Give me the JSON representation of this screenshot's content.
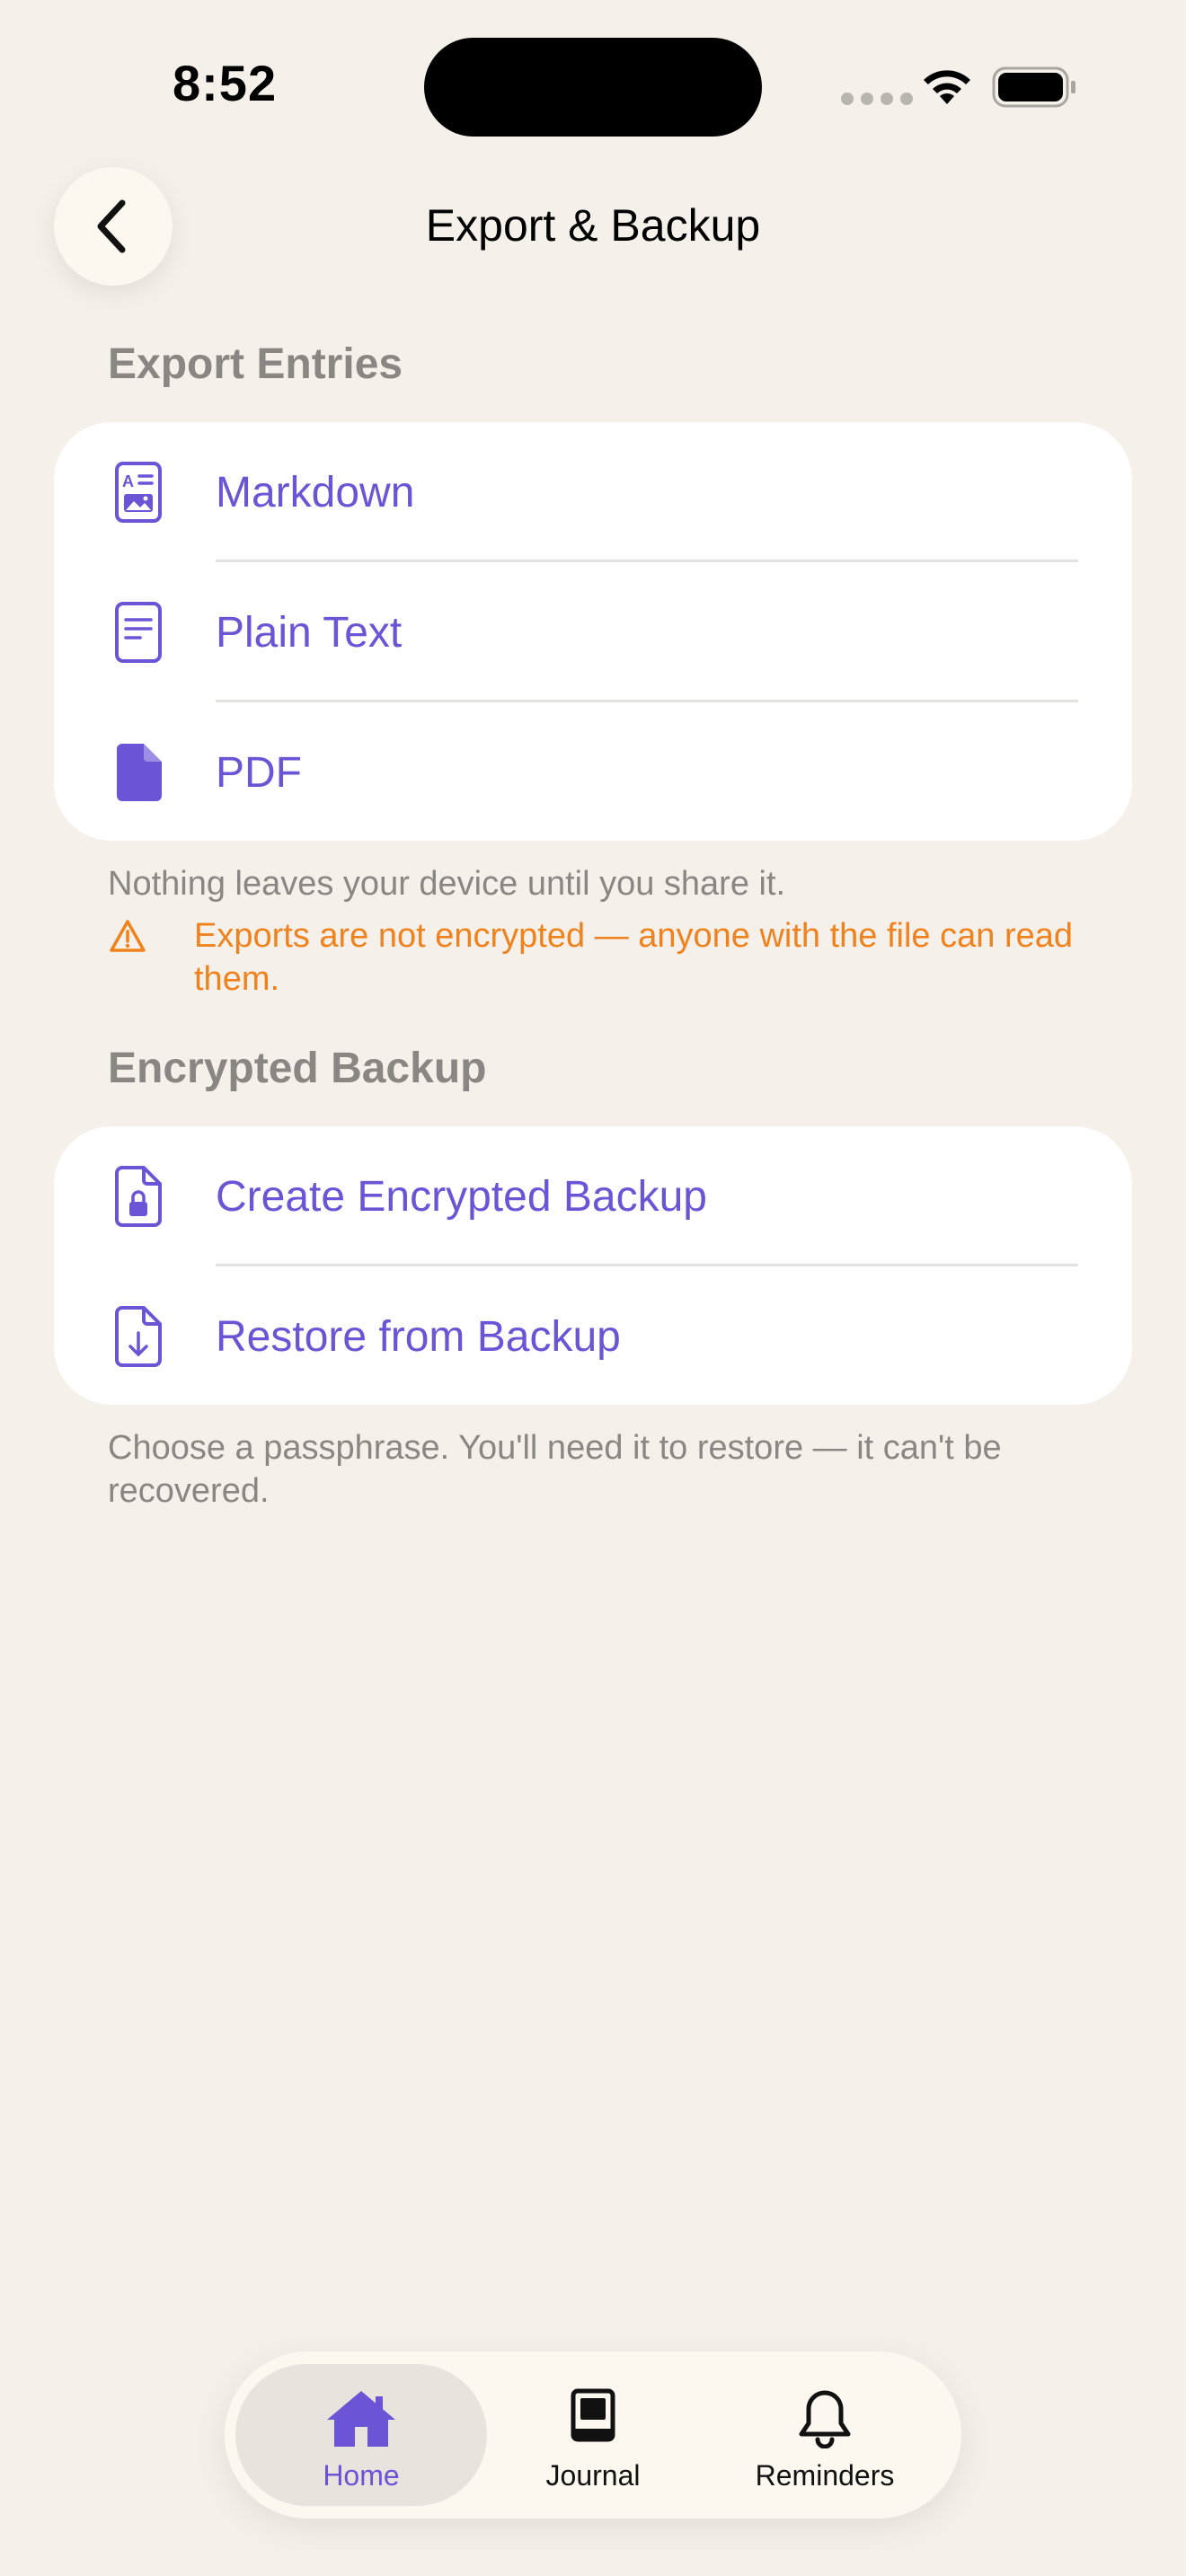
{
  "status_bar": {
    "time": "8:52"
  },
  "nav": {
    "title": "Export & Backup"
  },
  "export": {
    "header": "Export Entries",
    "items": [
      {
        "label": "Markdown",
        "icon": "markdown-doc-icon"
      },
      {
        "label": "Plain Text",
        "icon": "text-doc-icon"
      },
      {
        "label": "PDF",
        "icon": "pdf-doc-icon"
      }
    ],
    "note": "Nothing leaves your device until you share it.",
    "warning": "Exports are not encrypted — anyone with the file can read them."
  },
  "backup": {
    "header": "Encrypted Backup",
    "items": [
      {
        "label": "Create Encrypted Backup",
        "icon": "lock-doc-icon"
      },
      {
        "label": "Restore from Backup",
        "icon": "download-doc-icon"
      }
    ],
    "note": "Choose a passphrase. You'll need it to restore — it can't be recovered."
  },
  "tabbar": {
    "tabs": [
      {
        "label": "Home",
        "icon": "home-icon",
        "active": true
      },
      {
        "label": "Journal",
        "icon": "book-icon",
        "active": false
      },
      {
        "label": "Reminders",
        "icon": "bell-icon",
        "active": false
      }
    ]
  },
  "colors": {
    "accent": "#6B54D6",
    "warning": "#F0821E",
    "background": "#F5F0EA",
    "muted": "#8A8683"
  }
}
